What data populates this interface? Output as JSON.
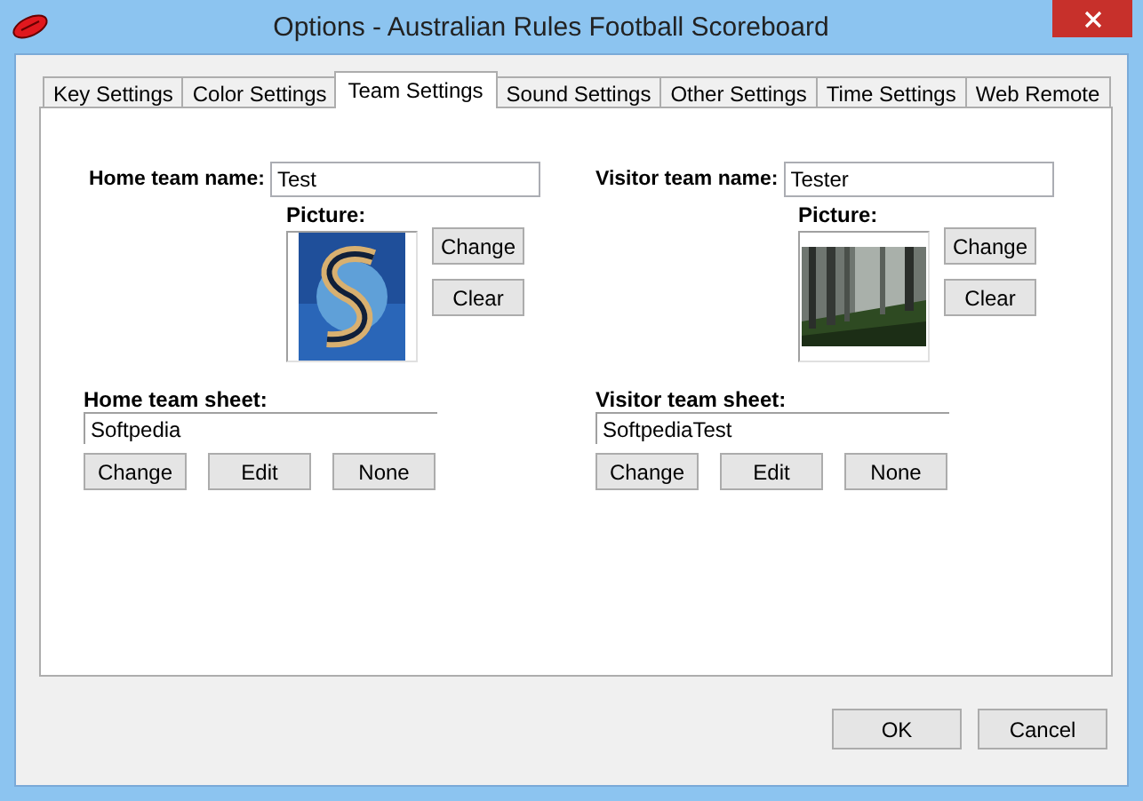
{
  "window": {
    "title": "Options - Australian Rules Football Scoreboard"
  },
  "tabs": [
    {
      "label": "Key Settings",
      "selected": false
    },
    {
      "label": "Color Settings",
      "selected": false
    },
    {
      "label": "Team Settings",
      "selected": true
    },
    {
      "label": "Sound Settings",
      "selected": false
    },
    {
      "label": "Other Settings",
      "selected": false
    },
    {
      "label": "Time Settings",
      "selected": false
    },
    {
      "label": "Web Remote",
      "selected": false
    }
  ],
  "teams": [
    {
      "name_label": "Home team name:",
      "name_value": "Test",
      "picture_label": "Picture:",
      "picture": {
        "kind": "picture"
      },
      "picture_buttons": [
        "Change",
        "Clear"
      ],
      "sheet_label": "Home team sheet:",
      "sheet_value": "Softpedia",
      "sheet_buttons": [
        "Change",
        "Edit",
        "None"
      ]
    },
    {
      "name_label": "Visitor team name:",
      "name_value": "Tester",
      "picture_label": "Picture:",
      "picture": {
        "kind": "picture"
      },
      "picture_buttons": [
        "Change",
        "Clear"
      ],
      "sheet_label": "Visitor team sheet:",
      "sheet_value": "SoftpediaTest",
      "sheet_buttons": [
        "Change",
        "Edit",
        "None"
      ]
    }
  ],
  "buttons": [
    "OK",
    "Cancel"
  ]
}
